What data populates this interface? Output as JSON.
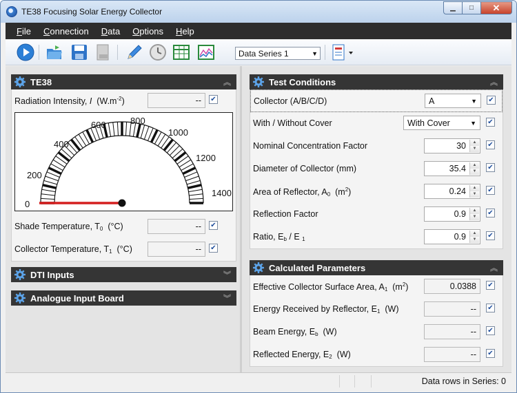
{
  "window": {
    "title": "TE38 Focusing Solar Energy Collector",
    "controls": {
      "minimize": "▁",
      "maximize": "□",
      "close": "✕"
    }
  },
  "menu": {
    "file": {
      "accel": "F",
      "rest": "ile"
    },
    "connection": {
      "accel": "C",
      "rest": "onnection"
    },
    "data": {
      "accel": "D",
      "rest": "ata"
    },
    "options": {
      "accel": "O",
      "rest": "ptions"
    },
    "help": {
      "accel": "H",
      "rest": "elp"
    }
  },
  "toolbar": {
    "series_select": "Data Series 1",
    "icons": [
      "play-icon",
      "open-folder-icon",
      "save-icon",
      "export-icon",
      "pencil-icon",
      "clock-icon",
      "table-icon",
      "graph-icon",
      "report-icon"
    ]
  },
  "te38": {
    "title": "TE38",
    "radiation_label": "Radiation Intensity, ",
    "radiation_symbol": "I",
    "radiation_unit_open": "(W.m",
    "radiation_unit_sup": "-2",
    "radiation_unit_close": ")",
    "radiation_value": "--",
    "radiation_checked": true,
    "gauge": {
      "value": 0,
      "min": 0,
      "max": 1400,
      "labels": [
        "0",
        "200",
        "400",
        "600",
        "800",
        "1000",
        "1200",
        "1400"
      ]
    },
    "shade_label": "Shade Temperature, T",
    "shade_sub": "0",
    "shade_unit": "(°C)",
    "shade_value": "--",
    "collector_label": "Collector Temperature, T",
    "collector_sub": "1",
    "collector_unit": "(°C)",
    "collector_value": "--"
  },
  "dti": {
    "title": "DTI Inputs"
  },
  "analogue": {
    "title": "Analogue Input Board"
  },
  "test_conditions": {
    "title": "Test Conditions",
    "collector_label": "Collector (A/B/C/D)",
    "collector_value": "A",
    "cover_label": "With / Without Cover",
    "cover_value": "With Cover",
    "ncf_label": "Nominal Concentration Factor",
    "ncf_value": "30",
    "diameter_label": "Diameter of Collector  (mm)",
    "diameter_value": "35.4",
    "area_label": "Area of Reflector, A",
    "area_sub": "0",
    "area_unit_open": "(m",
    "area_unit_sup": "2",
    "area_unit_close": ")",
    "area_value": "0.24",
    "reflection_label": "Reflection Factor",
    "reflection_value": "0.9",
    "ratio_label": "Ratio, E",
    "ratio_sub1": "b",
    "ratio_mid": " / E",
    "ratio_sub2": "1",
    "ratio_value": "0.9"
  },
  "calculated": {
    "title": "Calculated Parameters",
    "ecsa_label": "Effective Collector Surface Area, A",
    "ecsa_sub": "1",
    "ecsa_unit_open": "(m",
    "ecsa_unit_sup": "2",
    "ecsa_unit_close": ")",
    "ecsa_value": "0.0388",
    "received_label": "Energy Received by Reflector, E",
    "received_sub": "1",
    "received_unit": "(W)",
    "received_value": "--",
    "beam_label": "Beam Energy, E",
    "beam_sub": "b",
    "beam_unit": "(W)",
    "beam_value": "--",
    "reflected_label": "Reflected Energy, E",
    "reflected_sub": "2",
    "reflected_unit": "(W)",
    "reflected_value": "--"
  },
  "status": {
    "data_rows": "Data rows in Series: 0"
  },
  "colors": {
    "accent": "#2f74c8",
    "header": "#353535",
    "needle": "#d41f1f"
  }
}
